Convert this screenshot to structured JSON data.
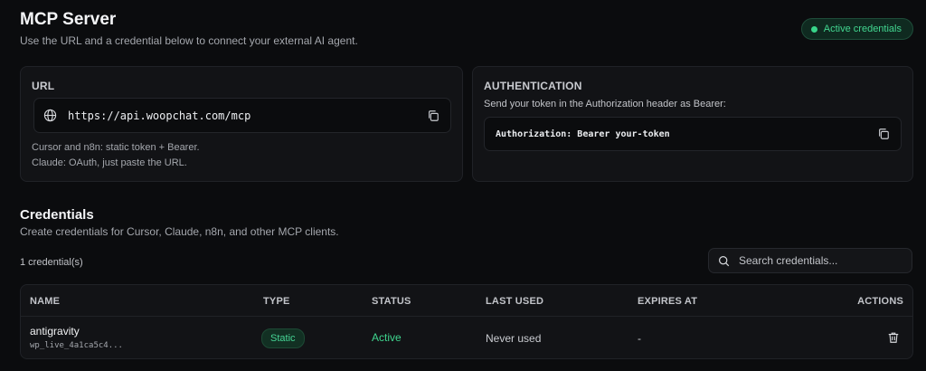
{
  "header": {
    "title": "MCP Server",
    "subtitle": "Use the URL and a credential below to connect your external AI agent.",
    "badge": "Active credentials"
  },
  "url_card": {
    "heading": "URL",
    "url": "https://api.woopchat.com/mcp",
    "note_1": "Cursor and n8n: static token + Bearer.",
    "note_2": "Claude: OAuth, just paste the URL."
  },
  "auth_card": {
    "heading": "AUTHENTICATION",
    "description": "Send your token in the Authorization header as Bearer:",
    "code": "Authorization: Bearer your-token"
  },
  "credentials": {
    "heading": "Credentials",
    "subtitle": "Create credentials for Cursor, Claude, n8n, and other MCP clients.",
    "count": "1 credential(s)",
    "search_placeholder": "Search credentials...",
    "columns": [
      "NAME",
      "TYPE",
      "STATUS",
      "LAST USED",
      "EXPIRES AT",
      "ACTIONS"
    ],
    "rows": [
      {
        "name": "antigravity",
        "prefix": "wp_live_4a1ca5c4...",
        "type": "Static",
        "status": "Active",
        "last_used": "Never used",
        "expires_at": "-"
      }
    ]
  },
  "icons": [
    "globe-icon",
    "copy-icon",
    "search-icon",
    "trash-icon"
  ],
  "colors": {
    "accent_green": "#3fd68f",
    "background": "#0b0c0e",
    "card": "#121316"
  }
}
